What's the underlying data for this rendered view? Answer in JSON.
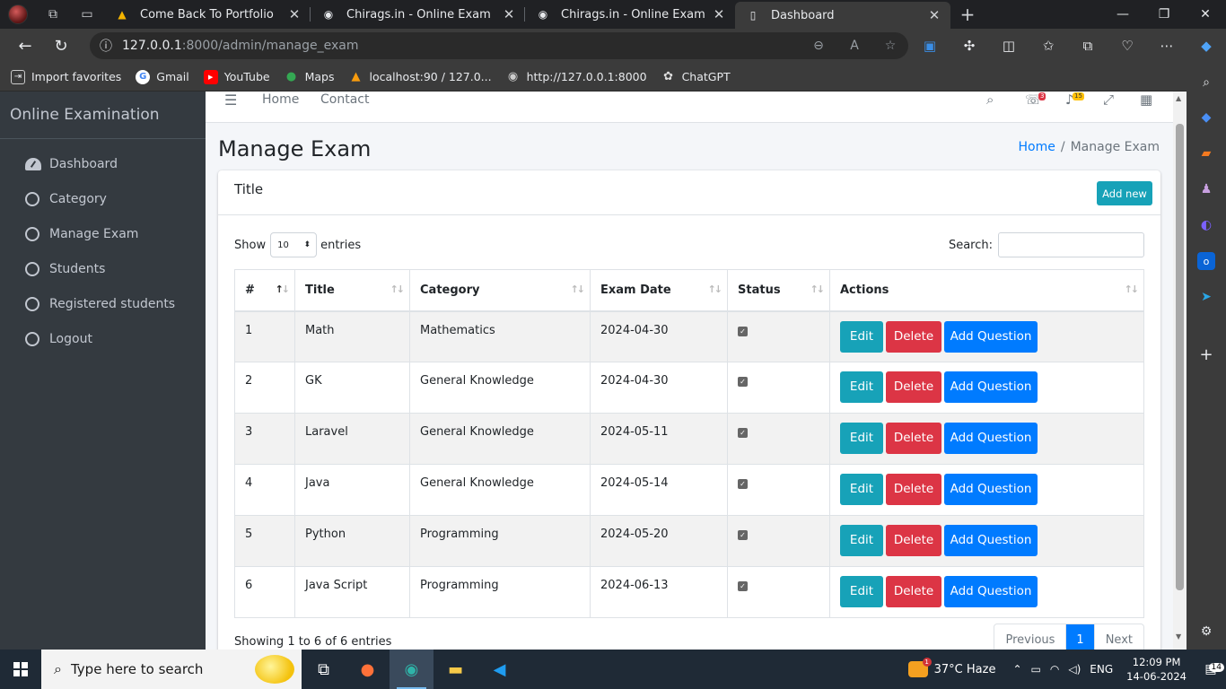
{
  "browser": {
    "tabs": [
      {
        "label": "Come Back To Portfolio",
        "icon": "portfolio-triangle-icon"
      },
      {
        "label": "Chirags.in - Online Exam",
        "icon": "globe-icon"
      },
      {
        "label": "Chirags.in - Online Exam",
        "icon": "globe-icon"
      },
      {
        "label": "Dashboard",
        "icon": "page-icon",
        "active": true
      }
    ],
    "url_host": "127.0.0.1",
    "url_rest": ":8000/admin/manage_exam",
    "favorites": [
      {
        "label": "Import favorites",
        "icon": "import-icon"
      },
      {
        "label": "Gmail",
        "icon": "google-icon"
      },
      {
        "label": "YouTube",
        "icon": "youtube-icon"
      },
      {
        "label": "Maps",
        "icon": "maps-pin-icon"
      },
      {
        "label": "localhost:90 / 127.0...",
        "icon": "phpmyadmin-icon"
      },
      {
        "label": "http://127.0.0.1:8000",
        "icon": "globe-icon"
      },
      {
        "label": "ChatGPT",
        "icon": "chatgpt-icon"
      }
    ]
  },
  "sidebar": {
    "brand": "Online Examination",
    "items": [
      {
        "label": "Dashboard",
        "icon": "dashboard-gauge-icon"
      },
      {
        "label": "Category",
        "icon": "circle-icon"
      },
      {
        "label": "Manage Exam",
        "icon": "circle-icon"
      },
      {
        "label": "Students",
        "icon": "circle-icon"
      },
      {
        "label": "Registered students",
        "icon": "circle-icon"
      },
      {
        "label": "Logout",
        "icon": "circle-icon"
      }
    ]
  },
  "topnav": {
    "links": [
      "Home",
      "Contact"
    ],
    "messages_count": "3",
    "notifications_count": "15"
  },
  "page": {
    "title": "Manage Exam",
    "breadcrumb_home": "Home",
    "breadcrumb_current": "Manage Exam"
  },
  "card": {
    "title": "Title",
    "add_button": "Add new",
    "show_label": "Show",
    "entries_value": "10",
    "entries_label": "entries",
    "search_label": "Search:",
    "search_value": ""
  },
  "table": {
    "headers": [
      "#",
      "Title",
      "Category",
      "Exam Date",
      "Status",
      "Actions"
    ],
    "rows": [
      {
        "id": "1",
        "title": "Math",
        "category": "Mathematics",
        "date": "2024-04-30",
        "status": true
      },
      {
        "id": "2",
        "title": "GK",
        "category": "General Knowledge",
        "date": "2024-04-30",
        "status": true
      },
      {
        "id": "3",
        "title": "Laravel",
        "category": "General Knowledge",
        "date": "2024-05-11",
        "status": true
      },
      {
        "id": "4",
        "title": "Java",
        "category": "General Knowledge",
        "date": "2024-05-14",
        "status": true
      },
      {
        "id": "5",
        "title": "Python",
        "category": "Programming",
        "date": "2024-05-20",
        "status": true
      },
      {
        "id": "6",
        "title": "Java Script",
        "category": "Programming",
        "date": "2024-06-13",
        "status": true
      }
    ],
    "actions": {
      "edit": "Edit",
      "delete": "Delete",
      "add_question": "Add Question"
    }
  },
  "footer": {
    "info": "Showing 1 to 6 of 6 entries",
    "previous": "Previous",
    "current_page": "1",
    "next": "Next"
  },
  "taskbar": {
    "search_placeholder": "Type here to search",
    "weather_temp": "37°C",
    "weather_text": "Haze",
    "weather_badge": "1",
    "language": "ENG",
    "time": "12:09 PM",
    "date": "14-06-2024",
    "notification_count": "14"
  },
  "colors": {
    "accent_info": "#17a2b8",
    "accent_danger": "#dc3545",
    "accent_primary": "#007bff",
    "sidebar_bg": "#343a40"
  }
}
